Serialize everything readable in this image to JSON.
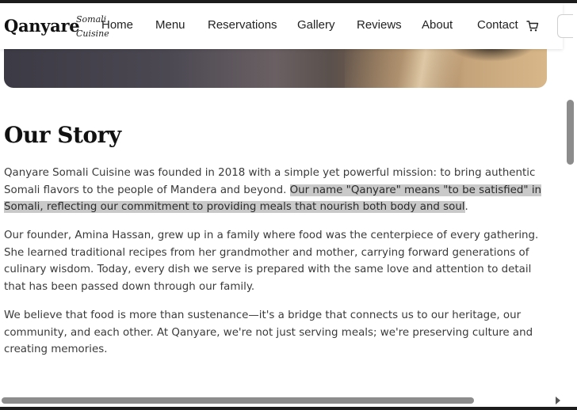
{
  "brand": {
    "name": "Qanyare",
    "tagline_line1": "Somali",
    "tagline_line2": "Cuisine"
  },
  "nav": {
    "items": [
      {
        "label": "Home"
      },
      {
        "label": "Menu"
      },
      {
        "label": "Reservations"
      },
      {
        "label": "Gallery"
      },
      {
        "label": "Reviews"
      },
      {
        "label": "About"
      },
      {
        "label": "Contact"
      }
    ],
    "cart_icon": "cart-icon"
  },
  "story": {
    "title": "Our Story",
    "p1_plain": "Qanyare Somali Cuisine was founded in 2018 with a simple yet powerful mission: to bring authentic Somali flavors to the people of Mandera and beyond. ",
    "p1_highlight": "Our name \"Qanyare\" means \"to be satisfied\" in Somali, reflecting our commitment to providing meals that nourish both body and soul",
    "p1_end": ".",
    "p2": "Our founder, Amina Hassan, grew up in a family where food was the centerpiece of every gathering. She learned traditional recipes from her grandmother and mother, carrying forward generations of culinary wisdom. Today, every dish we serve is prepared with the same love and attention to detail that has been passed down through our family.",
    "p3": "We believe that food is more than sustenance—it's a bridge that connects us to our heritage, our community, and each other. At Qanyare, we're not just serving meals; we're preserving culture and creating memories."
  },
  "colors": {
    "highlight": "#c9c9c9",
    "text": "#3a3a3a",
    "title": "#111111"
  }
}
